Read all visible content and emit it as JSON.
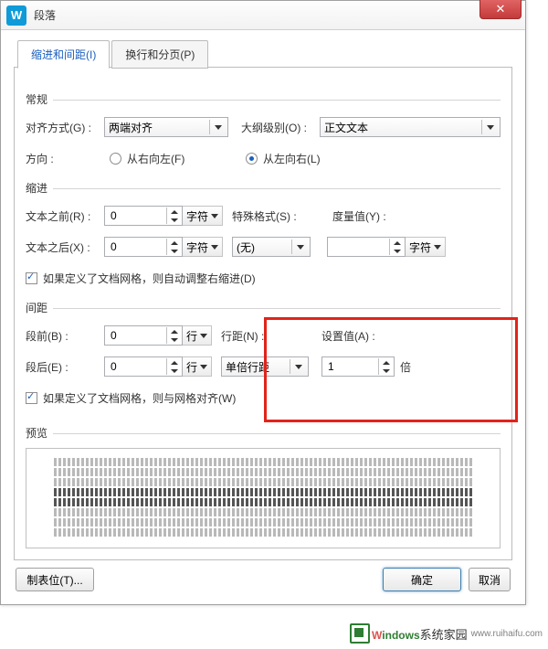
{
  "window": {
    "title": "段落"
  },
  "tabs": {
    "indent": "缩进和间距(I)",
    "pagination": "换行和分页(P)"
  },
  "general": {
    "label": "常规",
    "align_label": "对齐方式(G) :",
    "align_value": "两端对齐",
    "outline_label": "大纲级别(O) :",
    "outline_value": "正文文本",
    "direction_label": "方向 :",
    "rtl_label": "从右向左(F)",
    "ltr_label": "从左向右(L)"
  },
  "indent": {
    "label": "缩进",
    "before_label": "文本之前(R) :",
    "before_value": "0",
    "after_label": "文本之后(X) :",
    "after_value": "0",
    "unit": "字符",
    "special_label": "特殊格式(S) :",
    "special_value": "(无)",
    "measure_label": "度量值(Y) :",
    "measure_value": "",
    "measure_unit": "字符",
    "grid_check": "如果定义了文档网格，则自动调整右缩进(D)"
  },
  "spacing": {
    "label": "间距",
    "before_label": "段前(B) :",
    "before_value": "0",
    "after_label": "段后(E) :",
    "after_value": "0",
    "unit": "行",
    "line_label": "行距(N) :",
    "line_value": "单倍行距",
    "set_label": "设置值(A) :",
    "set_value": "1",
    "set_unit": "倍",
    "grid_check": "如果定义了文档网格，则与网格对齐(W)"
  },
  "preview": {
    "label": "预览"
  },
  "buttons": {
    "tabs": "制表位(T)...",
    "ok": "确定",
    "cancel": "取消"
  },
  "watermark": {
    "brand_w": "W",
    "brand_rest": "indows",
    "tagline": "系统家园",
    "url": "www.ruihaifu.com"
  }
}
